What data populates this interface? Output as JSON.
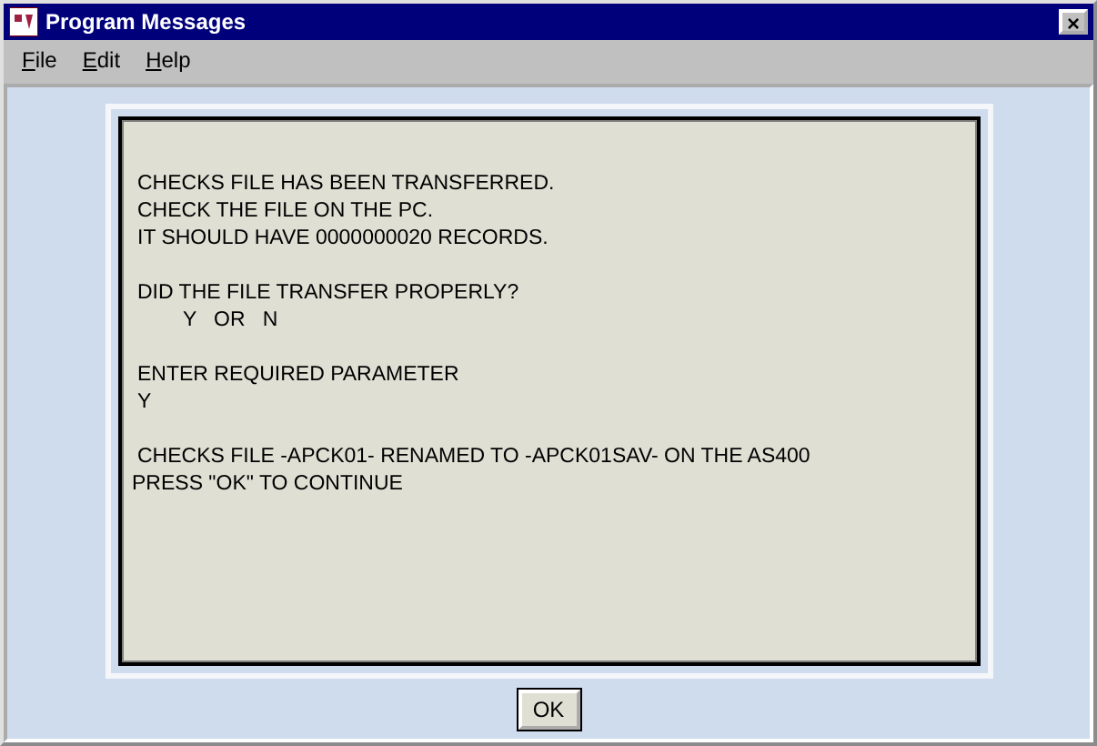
{
  "window": {
    "title": "Program Messages",
    "close": "×"
  },
  "menu": [
    {
      "label": "File",
      "mnemonic": true
    },
    {
      "label": "Edit",
      "mnemonic": true
    },
    {
      "label": "Help",
      "mnemonic": true
    }
  ],
  "message": {
    "paragraphs": [
      [
        {
          "text": "CHECKS FILE HAS BEEN TRANSFERRED.",
          "kind": "indent"
        },
        {
          "text": "CHECK THE FILE ON THE PC.",
          "kind": "indent"
        },
        {
          "text": "IT SHOULD HAVE 0000000020 RECORDS.",
          "kind": "indent"
        }
      ],
      [
        {
          "text": "DID THE FILE TRANSFER PROPERLY?",
          "kind": "indent"
        },
        {
          "text": "Y   OR   N",
          "kind": "deep"
        }
      ],
      [
        {
          "text": "ENTER REQUIRED PARAMETER",
          "kind": "indent"
        },
        {
          "text": "Y",
          "kind": "indent"
        }
      ],
      [
        {
          "text": "CHECKS FILE -APCK01- RENAMED TO -APCK01SAV- ON THE AS400",
          "kind": "indent"
        },
        {
          "text": "PRESS \"OK\" TO CONTINUE",
          "kind": "flush"
        }
      ]
    ]
  },
  "button": "OK"
}
